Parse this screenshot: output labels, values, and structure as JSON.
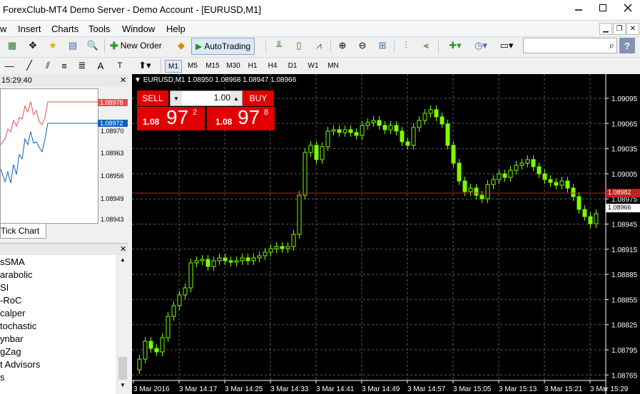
{
  "window": {
    "title": "ForexClub-MT4 Demo Server - Demo Account - [EURUSD,M1]"
  },
  "menu": [
    "w",
    "Insert",
    "Charts",
    "Tools",
    "Window",
    "Help"
  ],
  "toolbar": {
    "new_order": "New Order",
    "auto_trading": "AutoTrading",
    "timeframes": [
      "M1",
      "M5",
      "M15",
      "M30",
      "H1",
      "H4",
      "D1",
      "W1",
      "MN"
    ],
    "active_timeframe": "M1"
  },
  "tick_chart": {
    "time": "15:29:40",
    "price_labels": [
      "1.08978",
      "1.08972",
      "1.08970",
      "1.08963",
      "1.08956",
      "1.08949",
      "1.08943"
    ],
    "ask_label": "1.08978",
    "bid_label": "1.08972",
    "tab": "Tick Chart",
    "ask_color": "#e05050",
    "bid_color": "#1060c0"
  },
  "navigator": {
    "items": [
      "sSMA",
      "arabolic",
      "SI",
      "-RoC",
      "calper",
      "tochastic",
      "ynbar",
      "gZag",
      "t Advisors",
      "s"
    ]
  },
  "chart": {
    "info": "EURUSD,M1  1.08950 1.08968 1.08947 1.08966",
    "background": "#000000",
    "candle_color": "#7cfc00",
    "grid_color": "#5a5a5a",
    "price_labels": [
      "1.09095",
      "1.09065",
      "1.09035",
      "1.09005",
      "1.08975",
      "1.08945",
      "1.08915",
      "1.08885",
      "1.08855",
      "1.08825",
      "1.08795",
      "1.08765"
    ],
    "time_labels": [
      "3 Mar 2016",
      "3 Mar 14:17",
      "3 Mar 14:25",
      "3 Mar 14:33",
      "3 Mar 14:41",
      "3 Mar 14:49",
      "3 Mar 14:57",
      "3 Mar 15:05",
      "3 Mar 15:13",
      "3 Mar 15:21",
      "3 Mar 15:29"
    ],
    "ask_price": "1.08982",
    "bid_price": "1.08966",
    "ask_line_color": "#c02020"
  },
  "one_click": {
    "sell": "SELL",
    "buy": "BUY",
    "volume": "1.00",
    "sell_prefix": "1.08",
    "sell_big": "97",
    "sell_sup": "2",
    "buy_prefix": "1.08",
    "buy_big": "97",
    "buy_sup": "8"
  }
}
